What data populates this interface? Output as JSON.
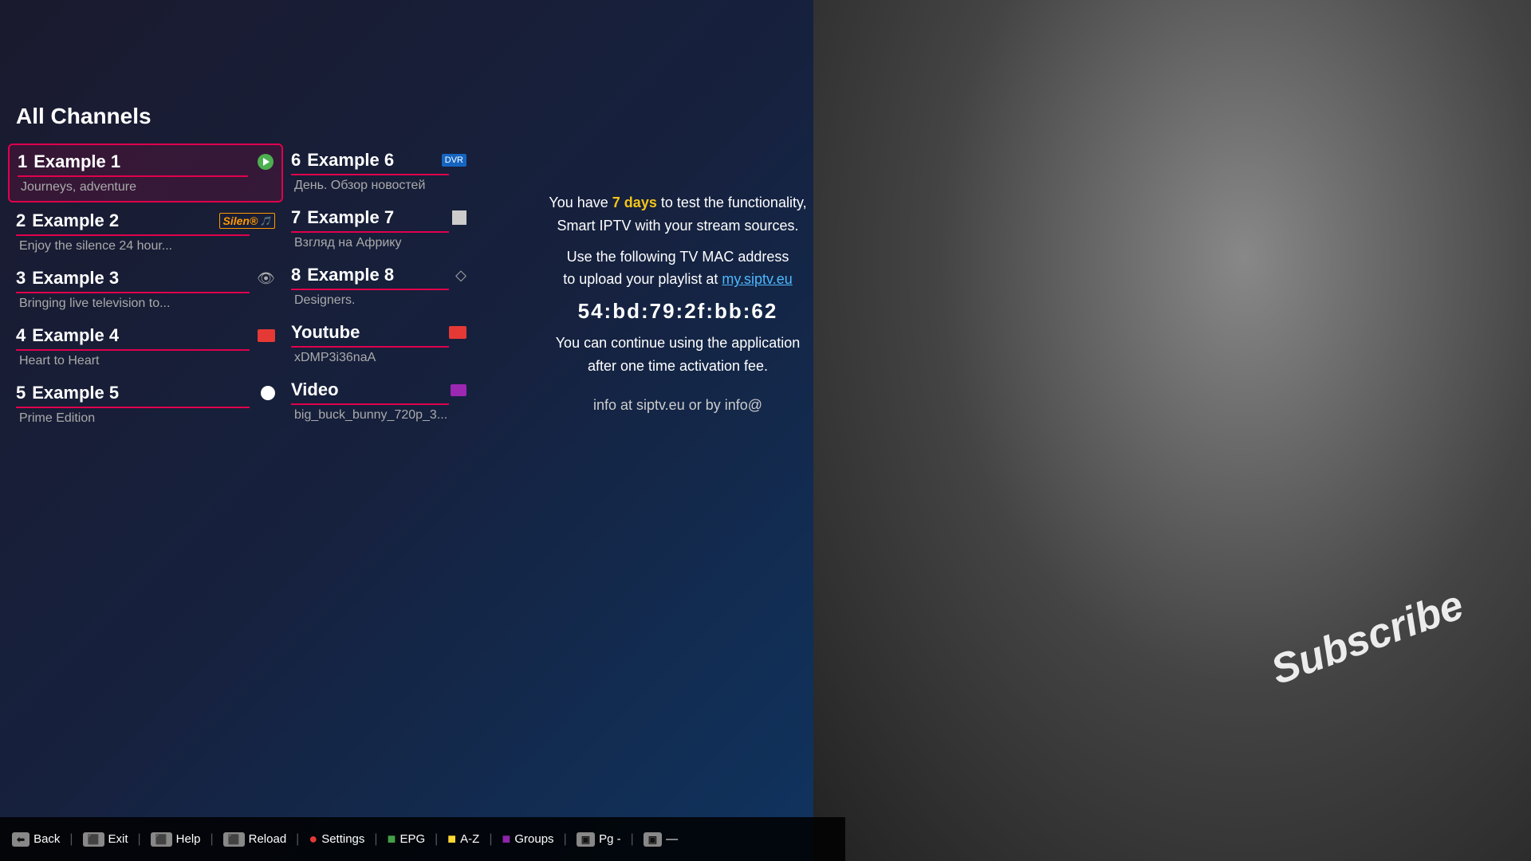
{
  "header": {
    "title": "All Channels"
  },
  "leftChannels": [
    {
      "number": "1",
      "name": "Example 1",
      "subtitle": "Journeys, adventure",
      "icon": "green",
      "selected": true
    },
    {
      "number": "2",
      "name": "Example 2",
      "subtitle": "Enjoy the silence 24 hour...",
      "icon": "silent",
      "selected": false
    },
    {
      "number": "3",
      "name": "Example 3",
      "subtitle": "Bringing live television to...",
      "icon": "eye",
      "selected": false
    },
    {
      "number": "4",
      "name": "Example 4",
      "subtitle": "Heart to Heart",
      "icon": "record",
      "selected": false
    },
    {
      "number": "5",
      "name": "Example 5",
      "subtitle": "Prime Edition",
      "icon": "circle",
      "selected": false
    }
  ],
  "rightChannels": [
    {
      "number": "6",
      "name": "Example 6",
      "subtitle": "День. Обзор новостей",
      "icon": "dvr",
      "selected": false
    },
    {
      "number": "7",
      "name": "Example 7",
      "subtitle": "Взгляд на Африку",
      "icon": "white-square",
      "selected": false
    },
    {
      "number": "8",
      "name": "Example 8",
      "subtitle": "Designers.",
      "icon": "eye",
      "selected": false
    },
    {
      "number": "",
      "name": "Youtube",
      "subtitle": "xDMP3i36naA",
      "icon": "record-red",
      "selected": false
    },
    {
      "number": "",
      "name": "Video",
      "subtitle": "big_buck_bunny_720p_3...",
      "icon": "purple",
      "selected": false
    }
  ],
  "infoPanel": {
    "line1": "You have ",
    "highlight1": "7 days",
    "line1b": " to test the functionality",
    "line2": "Smart IPTV with your stream sources.",
    "line3": "Use the following TV MAC address",
    "line4": "to upload your playlist at ",
    "link": "my.siptv.eu",
    "macAddress": "54:bd:79:2f:bb:62",
    "line5": "You can continue using the application",
    "line6": "after one time activation fee.",
    "line7": "info at siptv.eu or by info@"
  },
  "toolbar": {
    "items": [
      {
        "key": "Back",
        "keyColor": "gray",
        "label": "Back"
      },
      {
        "key": "Exit",
        "keyColor": "gray",
        "label": "Exit"
      },
      {
        "key": "Help",
        "keyColor": "gray",
        "label": "Help"
      },
      {
        "key": "Reload",
        "keyColor": "gray",
        "label": "Reload"
      },
      {
        "key": "●",
        "keyColor": "red",
        "label": "Settings"
      },
      {
        "key": "■",
        "keyColor": "green",
        "label": "EPG"
      },
      {
        "key": "■",
        "keyColor": "yellow",
        "label": "A-Z"
      },
      {
        "key": "■",
        "keyColor": "purple",
        "label": "Groups"
      },
      {
        "key": "Pg -",
        "keyColor": "gray",
        "label": "Pg -"
      },
      {
        "key": "—",
        "keyColor": "gray",
        "label": ""
      }
    ]
  },
  "subscribeLabel": "Subscribe"
}
